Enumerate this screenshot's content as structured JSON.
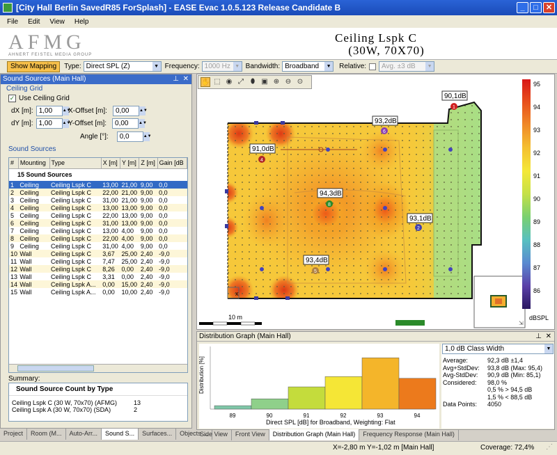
{
  "window": {
    "title": "[City Hall Berlin SavedR85 ForSplash] - EASE Evac 1.0.5.123 Release Candidate B"
  },
  "menu": [
    "File",
    "Edit",
    "View",
    "Help"
  ],
  "banner": {
    "logo": "AFMG",
    "logo_sub": "AHNERT FEISTEL MEDIA GROUP",
    "title": "Ceiling Lspk C",
    "subtitle": "(30W, 70X70)"
  },
  "toolbar": {
    "show_mapping": "Show Mapping",
    "type_label": "Type:",
    "type_value": "Direct SPL (Z)",
    "freq_label": "Frequency:",
    "freq_value": "1000 Hz",
    "bw_label": "Bandwidth:",
    "bw_value": "Broadband",
    "rel_label": "Relative:",
    "rel_value": "Avg. ±3 dB"
  },
  "left": {
    "header": "Sound Sources (Main Hall)",
    "grid_section": "Ceiling Grid",
    "use_grid": "Use Ceiling Grid",
    "dx_label": "dX [m]:",
    "dx": "1,00",
    "dy_label": "dY [m]:",
    "dy": "1,00",
    "xoff_label": "X-Offset [m]:",
    "xoff": "0,00",
    "yoff_label": "Y-Offset [m]:",
    "yoff": "0,00",
    "angle_label": "Angle [°]:",
    "angle": "0,0",
    "sources_section": "Sound Sources",
    "columns": [
      "#",
      "Mounting",
      "Type",
      "X [m]",
      "Y [m]",
      "Z [m]",
      "Gain [dB"
    ],
    "group_label": "15 Sound Sources",
    "rows": [
      [
        "1",
        "Ceiling",
        "Ceiling Lspk C",
        "13,00",
        "21,00",
        "9,00",
        "0,0"
      ],
      [
        "2",
        "Ceiling",
        "Ceiling Lspk C",
        "22,00",
        "21,00",
        "9,00",
        "0,0"
      ],
      [
        "3",
        "Ceiling",
        "Ceiling Lspk C",
        "31,00",
        "21,00",
        "9,00",
        "0,0"
      ],
      [
        "4",
        "Ceiling",
        "Ceiling Lspk C",
        "13,00",
        "13,00",
        "9,00",
        "0,0"
      ],
      [
        "5",
        "Ceiling",
        "Ceiling Lspk C",
        "22,00",
        "13,00",
        "9,00",
        "0,0"
      ],
      [
        "6",
        "Ceiling",
        "Ceiling Lspk C",
        "31,00",
        "13,00",
        "9,00",
        "0,0"
      ],
      [
        "7",
        "Ceiling",
        "Ceiling Lspk C",
        "13,00",
        "4,00",
        "9,00",
        "0,0"
      ],
      [
        "8",
        "Ceiling",
        "Ceiling Lspk C",
        "22,00",
        "4,00",
        "9,00",
        "0,0"
      ],
      [
        "9",
        "Ceiling",
        "Ceiling Lspk C",
        "31,00",
        "4,00",
        "9,00",
        "0,0"
      ],
      [
        "10",
        "Wall",
        "Ceiling Lspk C",
        "3,67",
        "25,00",
        "2,40",
        "-9,0"
      ],
      [
        "11",
        "Wall",
        "Ceiling Lspk C",
        "7,47",
        "25,00",
        "2,40",
        "-9,0"
      ],
      [
        "12",
        "Wall",
        "Ceiling Lspk C",
        "8,26",
        "0,00",
        "2,40",
        "-9,0"
      ],
      [
        "13",
        "Wall",
        "Ceiling Lspk C",
        "3,31",
        "0,00",
        "2,40",
        "-9,0"
      ],
      [
        "14",
        "Wall",
        "Ceiling Lspk A...",
        "0,00",
        "15,00",
        "2,40",
        "-9,0"
      ],
      [
        "15",
        "Wall",
        "Ceiling Lspk A...",
        "0,00",
        "10,00",
        "2,40",
        "-9,0"
      ]
    ],
    "summary_label": "Summary:",
    "summary_title": "Sound Source Count by Type",
    "summary_rows": [
      [
        "Ceiling Lspk C (30 W, 70x70) (AFMG)",
        "13"
      ],
      [
        "Ceiling Lspk A (30 W, 70x70) (SDA)",
        "2"
      ]
    ],
    "tabs": [
      "Project",
      "Room (M...",
      "Auto-Arr...",
      "Sound S...",
      "Surfaces...",
      "Objects ..."
    ]
  },
  "map": {
    "labels": [
      {
        "text": "90,1dB",
        "n": "1"
      },
      {
        "text": "93,2dB",
        "n": "6"
      },
      {
        "text": "91,0dB",
        "n": "4"
      },
      {
        "text": "94,3dB",
        "n": "8"
      },
      {
        "text": "93,1dB",
        "n": "2"
      },
      {
        "text": "93,4dB",
        "n": "5"
      }
    ],
    "scale_text": "10 m",
    "coord_tag": "x",
    "colorscale": {
      "ticks": [
        "95",
        "94",
        "93",
        "92",
        "91",
        "90",
        "89",
        "88",
        "87",
        "86"
      ],
      "unit": "dBSPL"
    }
  },
  "dist": {
    "header": "Distribution Graph (Main Hall)",
    "class_width": "1,0 dB Class Width",
    "stats": [
      [
        "Average:",
        "92,3 dB ±1,4"
      ],
      [
        "Avg+StdDev:",
        "93,8 dB (Max: 95,4)"
      ],
      [
        "Avg-StdDev:",
        "90,9 dB (Min: 85,1)"
      ],
      [
        "Considered:",
        "98,0 %"
      ],
      [
        "",
        "0,5 % > 94,5 dB"
      ],
      [
        "",
        "1,5 % < 88,5 dB"
      ],
      [
        "Data Points:",
        "4050"
      ]
    ],
    "tabs": [
      "Side View",
      "Front View",
      "Distribution Graph (Main Hall)",
      "Frequency Response (Main Hall)"
    ]
  },
  "chart_data": {
    "type": "bar",
    "categories": [
      "89",
      "90",
      "91",
      "92",
      "93",
      "94"
    ],
    "values": [
      2.0,
      6.0,
      13.0,
      19.0,
      30.0,
      18.0
    ],
    "first_bar_values": [
      1.5
    ],
    "xlabel": "Direct SPL [dB] for Broadband, Weighting: Flat",
    "ylabel": "Distribution [%]",
    "ylim": [
      0,
      35
    ],
    "colors": [
      "#7fc7a8",
      "#8fd08a",
      "#c4dc3c",
      "#f5e636",
      "#f4b52a",
      "#ec7a1c"
    ]
  },
  "status": {
    "coords": "X=-2,80 m  Y=-1,02 m [Main Hall]",
    "coverage": "Coverage: 72,4%"
  }
}
